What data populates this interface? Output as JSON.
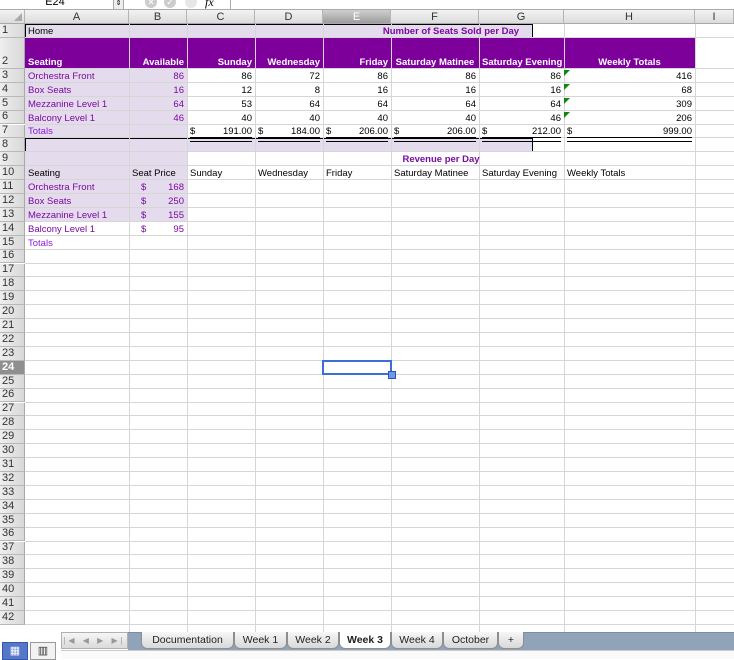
{
  "formula_bar": {
    "name_box": "E24",
    "cancel_icon": "cancel-icon",
    "confirm_icon": "confirm-icon",
    "fx_label": "fx",
    "formula": ""
  },
  "columns": [
    "A",
    "B",
    "C",
    "D",
    "E",
    "F",
    "G",
    "H",
    "I"
  ],
  "selected_column": "E",
  "rows": [
    "1",
    "2",
    "3",
    "4",
    "5",
    "6",
    "7",
    "8",
    "9",
    "10",
    "11",
    "12",
    "13",
    "14",
    "15",
    "16",
    "17",
    "18",
    "19",
    "20",
    "21",
    "22",
    "23",
    "24",
    "25",
    "26",
    "27",
    "28",
    "29",
    "30",
    "31",
    "32",
    "33",
    "34",
    "35",
    "36",
    "37",
    "38",
    "39",
    "40",
    "41",
    "42"
  ],
  "selected_row": "24",
  "selected_cell": "E24",
  "sheet": {
    "a1": "Home",
    "seats_title": "Number of Seats Sold per Day",
    "seats_header": [
      "Seating",
      "Available",
      "Sunday",
      "Wednesday",
      "Friday",
      "Saturday Matinee",
      "Saturday Evening",
      "Weekly Totals"
    ],
    "seats_rows": [
      {
        "name": "Orchestra  Front",
        "available": "86",
        "values": [
          "86",
          "72",
          "86",
          "86",
          "86"
        ],
        "total": "416"
      },
      {
        "name": "Box Seats",
        "available": "16",
        "values": [
          "12",
          "8",
          "16",
          "16",
          "16"
        ],
        "total": "68"
      },
      {
        "name": "Mezzanine Level 1",
        "available": "64",
        "values": [
          "53",
          "64",
          "64",
          "64",
          "64"
        ],
        "total": "309"
      },
      {
        "name": "Balcony Level 1",
        "available": "46",
        "values": [
          "40",
          "40",
          "40",
          "40",
          "46"
        ],
        "total": "206"
      }
    ],
    "seats_totals": {
      "label": "Totals",
      "currency": "$",
      "values": [
        "191.00",
        "184.00",
        "206.00",
        "206.00",
        "212.00"
      ],
      "total": "999.00"
    },
    "revenue_title": "Revenue per Day",
    "revenue_header": [
      "Seating",
      "Seat Price",
      "Sunday",
      "Wednesday",
      "Friday",
      "Saturday Matinee",
      "Saturday Evening",
      "Weekly Totals"
    ],
    "revenue_rows": [
      {
        "name": "Orchestra  Front",
        "currency": "$",
        "price": "168"
      },
      {
        "name": "Box Seats",
        "currency": "$",
        "price": "250"
      },
      {
        "name": "Mezzanine Level 1",
        "currency": "$",
        "price": "155"
      },
      {
        "name": "Balcony Level 1",
        "currency": "$",
        "price": "95"
      }
    ],
    "revenue_totals_label": "Totals"
  },
  "colors": {
    "header_purple": "#7d009a",
    "lavender": "#e4dbec",
    "text_purple": "#7a0aa0",
    "selection_blue": "#3b6fd4"
  },
  "tabs": [
    {
      "label": "Documentation",
      "active": false
    },
    {
      "label": "Week 1",
      "active": false
    },
    {
      "label": "Week 2",
      "active": false
    },
    {
      "label": "Week 3",
      "active": true
    },
    {
      "label": "Week 4",
      "active": false
    },
    {
      "label": "October",
      "active": false
    },
    {
      "label": "+",
      "active": false
    }
  ],
  "nav_buttons": "|◀ ◀ ▶ ▶|",
  "view_buttons": {
    "normal": "normal-view-icon",
    "page_layout": "page-layout-view-icon"
  }
}
